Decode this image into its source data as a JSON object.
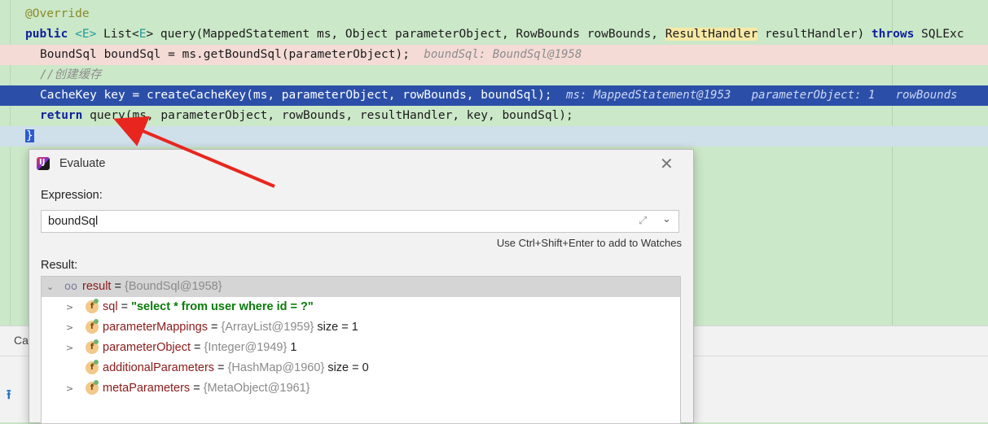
{
  "editor": {
    "lines": [
      {
        "anno": "@Override"
      },
      {
        "kw1": "public",
        "gen1": "<E>",
        "t1": " List<",
        "gen2": "E",
        "t2": "> query(MappedStatement ms, Object parameterObject, RowBounds rowBounds, ",
        "hl": "ResultHandler",
        "t3": " resultHandler) ",
        "kw2": "throws",
        "t4": " SQLExc"
      },
      {
        "code": "BoundSql boundSql = ms.getBoundSql(parameterObject);",
        "hint": "boundSql: BoundSql@1958"
      },
      {
        "comment": "//创建缓存"
      },
      {
        "code": "CacheKey key = createCacheKey(ms, parameterObject, rowBounds, boundSql);",
        "hint": "ms: MappedStatement@1953   parameterObject: 1   rowBounds"
      },
      {
        "kw": "return",
        "code": " query(ms, parameterObject, rowBounds, resultHandler, key, boundSql);"
      },
      {
        "brace": "}"
      }
    ]
  },
  "bottom_panel": {
    "tab": "Ca"
  },
  "dialog": {
    "title": "Evaluate",
    "expression_label": "Expression:",
    "expression_value": "boundSql",
    "hint": "Use Ctrl+Shift+Enter to add to Watches",
    "result_label": "Result:",
    "rows": [
      {
        "name": "result",
        "eq": " = ",
        "value": "{BoundSql@1958}"
      },
      {
        "name": "sql",
        "eq": " = ",
        "value": "\"select * from user where id = ?\""
      },
      {
        "name": "parameterMappings",
        "eq": " = ",
        "value": "{ArrayList@1959}",
        "extra": "size = 1"
      },
      {
        "name": "parameterObject",
        "eq": " = ",
        "value": "{Integer@1949}",
        "extra": "1"
      },
      {
        "name": "additionalParameters",
        "eq": " = ",
        "value": "{HashMap@1960}",
        "extra": "size = 0"
      },
      {
        "name": "metaParameters",
        "eq": " = ",
        "value": "{MetaObject@1961}"
      }
    ]
  },
  "colors": {
    "selection": "#2b4fa8",
    "editor_bg": "#cbe8c8",
    "error_line": "#f4dbd6",
    "annotation_arrow": "#e8261f"
  }
}
